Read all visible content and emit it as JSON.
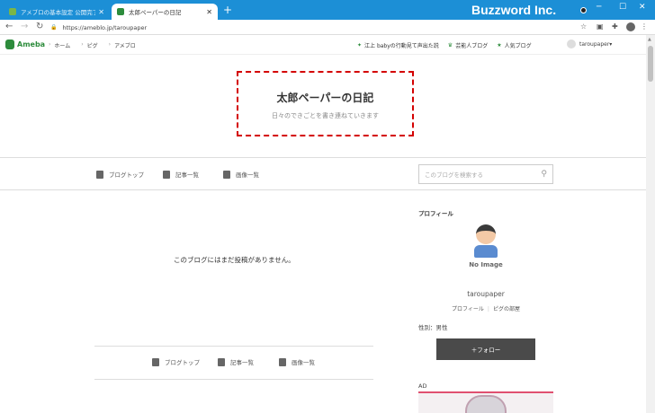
{
  "browser": {
    "tabs": [
      {
        "title": "アメブロの基本設定 公開完了 | aさ",
        "active": false
      },
      {
        "title": "太郎ペーパーの日記",
        "active": true
      }
    ],
    "url": "https://ameblo.jp/taroupaper",
    "watermark": "Buzzword Inc."
  },
  "ameba": {
    "logo": "Ameba",
    "crumbs": [
      "ホーム",
      "ピグ",
      "アメブロ"
    ],
    "links": [
      "江上 babyの行動見て声出た説",
      "芸能人ブログ",
      "人気ブログ"
    ],
    "user": "taroupaper"
  },
  "blog": {
    "title": "太郎ペーパーの日記",
    "subtitle": "日々のできごとを書き連ねていきます",
    "nav": [
      "ブログトップ",
      "記事一覧",
      "画像一覧"
    ],
    "search_placeholder": "このブログを検索する",
    "empty_message": "このブログにはまだ投稿がありません。"
  },
  "sidebar": {
    "profile_heading": "プロフィール",
    "no_image": "No Image",
    "username": "taroupaper",
    "profile_link": "プロフィール",
    "pig_link": "ピグの部屋",
    "gender": "性別：男性",
    "follow": "＋フォロー",
    "ad_label": "AD"
  }
}
